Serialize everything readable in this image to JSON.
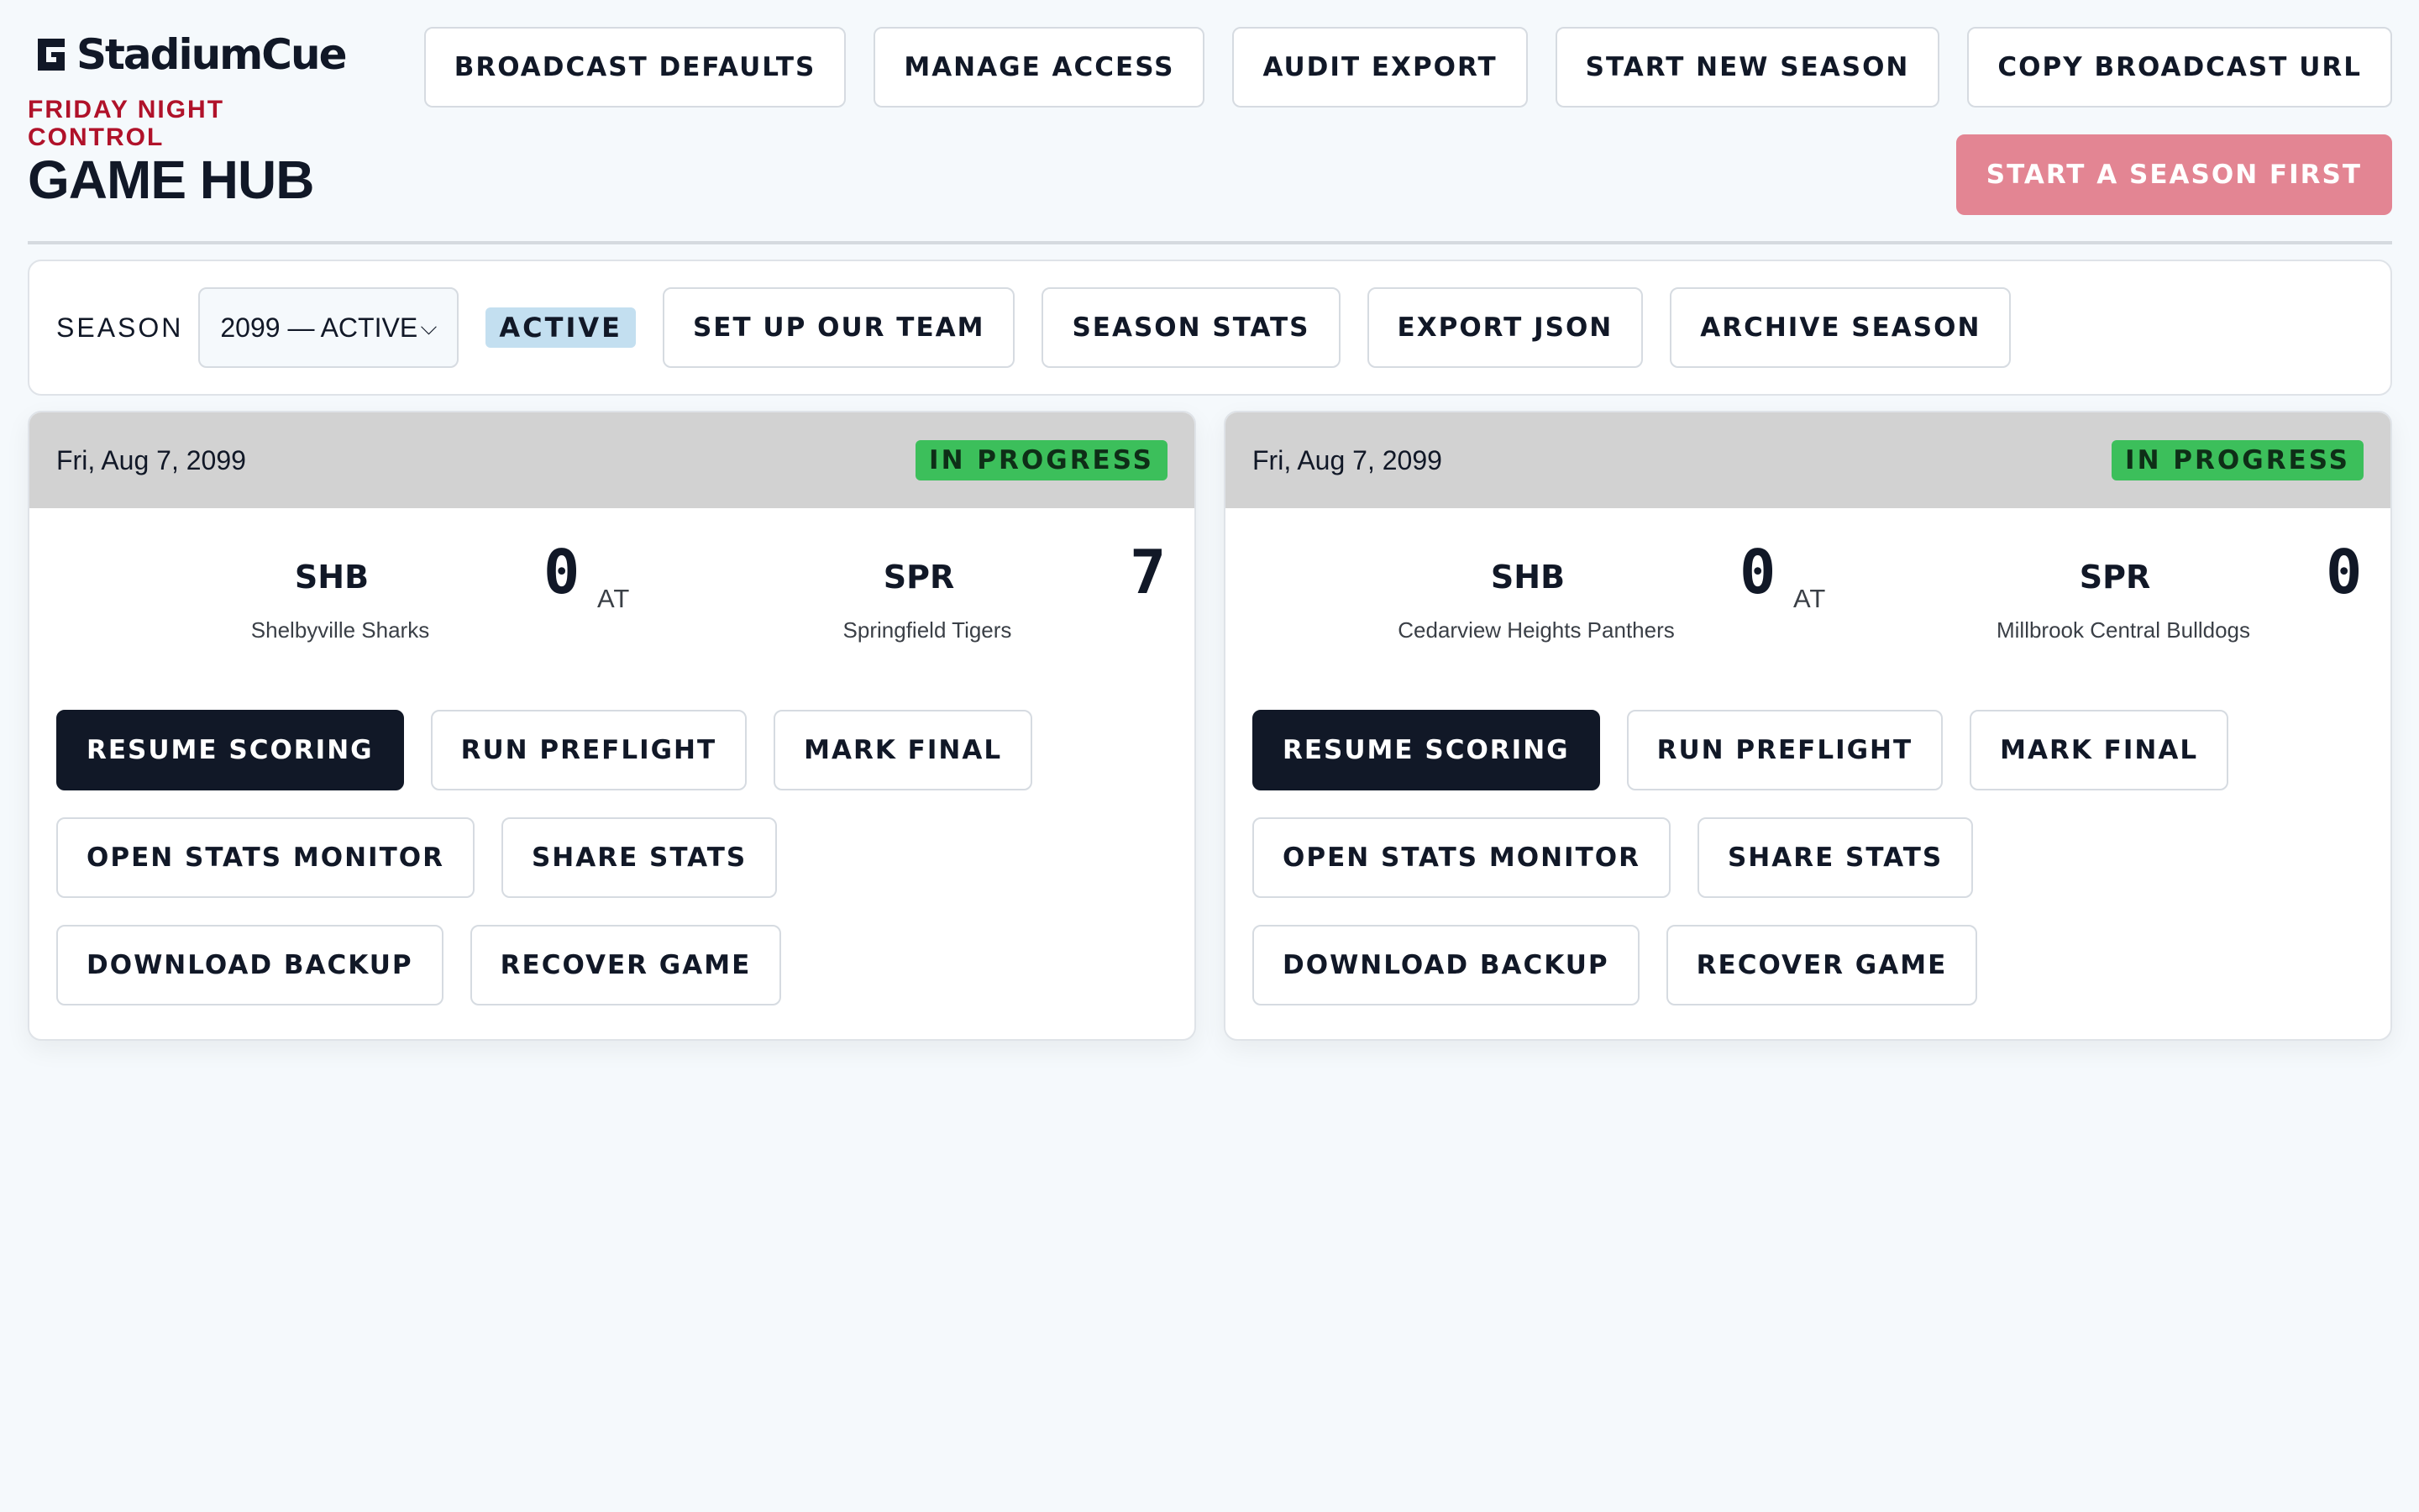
{
  "brand": {
    "name": "StadiumCue"
  },
  "header": {
    "eyebrow": "FRIDAY NIGHT CONTROL",
    "title": "GAME HUB",
    "actions": [
      {
        "label": "BROADCAST DEFAULTS"
      },
      {
        "label": "MANAGE ACCESS"
      },
      {
        "label": "AUDIT EXPORT"
      },
      {
        "label": "START NEW SEASON"
      },
      {
        "label": "COPY BROADCAST URL"
      }
    ],
    "start_first_label": "START A SEASON FIRST"
  },
  "season_bar": {
    "label": "SEASON",
    "selected": "2099 — ACTIVE",
    "badge": "ACTIVE",
    "buttons": [
      {
        "label": "SET UP OUR TEAM"
      },
      {
        "label": "SEASON STATS"
      },
      {
        "label": "EXPORT JSON"
      },
      {
        "label": "ARCHIVE SEASON"
      }
    ]
  },
  "games": [
    {
      "date": "Fri, Aug 7, 2099",
      "status": "IN PROGRESS",
      "away": {
        "abbr": "SHB",
        "name": "Shelbyville Sharks",
        "score": "0"
      },
      "at": "AT",
      "home": {
        "abbr": "SPR",
        "name": "Springfield Tigers",
        "score": "7"
      },
      "buttons": {
        "resume": "RESUME SCORING",
        "preflight": "RUN PREFLIGHT",
        "final": "MARK FINAL",
        "monitor": "OPEN STATS MONITOR",
        "share": "SHARE STATS",
        "backup": "DOWNLOAD BACKUP",
        "recover": "RECOVER GAME"
      }
    },
    {
      "date": "Fri, Aug 7, 2099",
      "status": "IN PROGRESS",
      "away": {
        "abbr": "SHB",
        "name": "Cedarview Heights Panthers",
        "score": "0"
      },
      "at": "AT",
      "home": {
        "abbr": "SPR",
        "name": "Millbrook Central Bulldogs",
        "score": "0"
      },
      "buttons": {
        "resume": "RESUME SCORING",
        "preflight": "RUN PREFLIGHT",
        "final": "MARK FINAL",
        "monitor": "OPEN STATS MONITOR",
        "share": "SHARE STATS",
        "backup": "DOWNLOAD BACKUP",
        "recover": "RECOVER GAME"
      }
    }
  ],
  "colors": {
    "background": "#f5f9fc",
    "accent_red": "#b0122a",
    "disabled_cta": "#e38593",
    "status_green": "#3cbf5b",
    "active_pill": "#c3dff0",
    "dark_button": "#111827"
  },
  "icons": {
    "brand": "stadiumcue-logo-icon",
    "select": "chevron-down-icon"
  }
}
